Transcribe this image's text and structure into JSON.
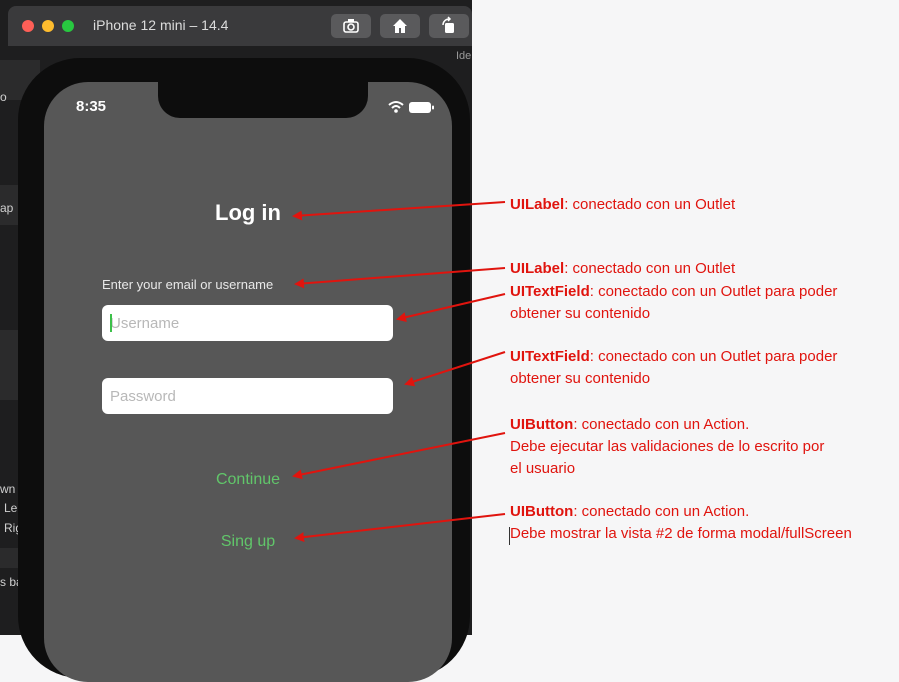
{
  "window": {
    "title": "iPhone 12 mini – 14.4",
    "ide_label": "Ide"
  },
  "xcode_fragments": [
    "o",
    "ap",
    "wn",
    "Le",
    "Rig",
    "s ba"
  ],
  "status_bar": {
    "time": "8:35"
  },
  "login": {
    "title": "Log in",
    "prompt": "Enter your email or username",
    "username_placeholder": "Username",
    "password_placeholder": "Password",
    "continue_label": "Continue",
    "signup_label": "Sing up"
  },
  "annotations": [
    {
      "kind": "UILabel",
      "text": ":  conectado con un Outlet"
    },
    {
      "kind": "UILabel",
      "text": ":  conectado con un Outlet"
    },
    {
      "kind": "UITextField",
      "text": ": conectado con un Outlet para poder",
      "line2": "obtener su contenido"
    },
    {
      "kind": "UITextField",
      "text": ": conectado con un Outlet para poder",
      "line2": "obtener su contenido"
    },
    {
      "kind": "UIButton",
      "text": ": conectado con un Action.",
      "line2": "Debe ejecutar las validaciones de lo escrito por",
      "line3": "el usuario"
    },
    {
      "kind": "UIButton",
      "text": ": conectado con un Action.",
      "line2": "Debe mostrar la vista #2 de forma modal/fullScreen"
    }
  ],
  "colors": {
    "annotation": "#e0140e",
    "button_text": "#61c66a",
    "screen_bg": "#575757"
  }
}
